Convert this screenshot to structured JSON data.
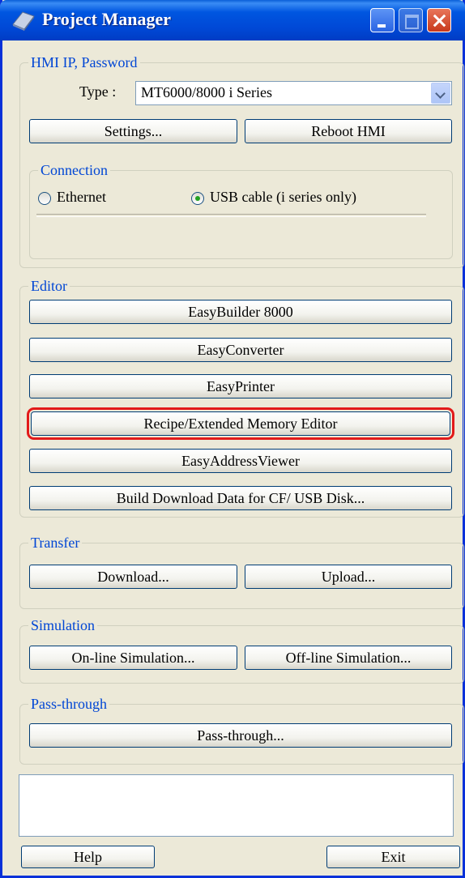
{
  "window": {
    "title": "Project Manager",
    "icons": [
      "app-icon",
      "minimize-icon",
      "maximize-icon",
      "close-icon"
    ]
  },
  "hmi": {
    "legend": "HMI IP, Password",
    "type_label": "Type :",
    "type_value": "MT6000/8000 i Series",
    "settings_label": "Settings...",
    "reboot_label": "Reboot HMI",
    "connection": {
      "legend": "Connection",
      "ethernet_label": "Ethernet",
      "usb_label": "USB cable (i series only)",
      "selected": "usb"
    }
  },
  "editor": {
    "legend": "Editor",
    "buttons": [
      "EasyBuilder 8000",
      "EasyConverter",
      "EasyPrinter",
      "Recipe/Extended Memory Editor",
      "EasyAddressViewer",
      "Build Download Data for CF/ USB Disk..."
    ]
  },
  "transfer": {
    "legend": "Transfer",
    "download_label": "Download...",
    "upload_label": "Upload..."
  },
  "simulation": {
    "legend": "Simulation",
    "online_label": "On-line Simulation...",
    "offline_label": "Off-line Simulation..."
  },
  "passthrough": {
    "legend": "Pass-through",
    "button_label": "Pass-through..."
  },
  "footer": {
    "help_label": "Help",
    "exit_label": "Exit"
  },
  "colors": {
    "titlebar": "#0054e3",
    "legend_text": "#0046d5",
    "highlight": "#e21a1a",
    "face": "#ece9d8"
  }
}
